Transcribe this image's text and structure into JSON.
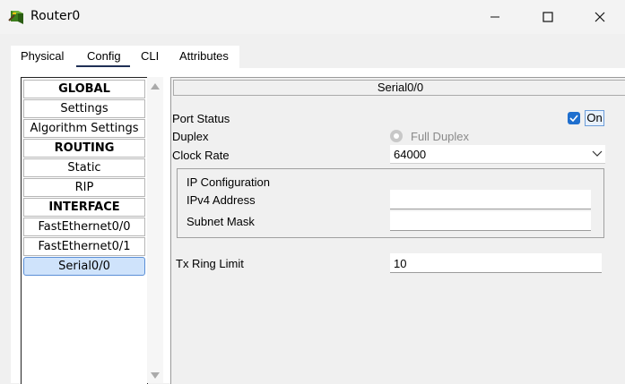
{
  "window": {
    "title": "Router0",
    "icon": "router-icon"
  },
  "tabs": [
    {
      "label": "Physical"
    },
    {
      "label": "Config",
      "active": true
    },
    {
      "label": "CLI"
    },
    {
      "label": "Attributes"
    }
  ],
  "nav": {
    "items": [
      {
        "label": "GLOBAL",
        "type": "header"
      },
      {
        "label": "Settings",
        "type": "item"
      },
      {
        "label": "Algorithm Settings",
        "type": "item"
      },
      {
        "label": "ROUTING",
        "type": "header"
      },
      {
        "label": "Static",
        "type": "item"
      },
      {
        "label": "RIP",
        "type": "item"
      },
      {
        "label": "INTERFACE",
        "type": "header"
      },
      {
        "label": "FastEthernet0/0",
        "type": "item"
      },
      {
        "label": "FastEthernet0/1",
        "type": "item"
      },
      {
        "label": "Serial0/0",
        "type": "item",
        "selected": true
      }
    ]
  },
  "panel": {
    "title": "Serial0/0",
    "port_status": {
      "label": "Port Status",
      "checked": true,
      "on_label": "On"
    },
    "duplex": {
      "label": "Duplex",
      "option_label": "Full Duplex",
      "disabled": true
    },
    "clock_rate": {
      "label": "Clock Rate",
      "value": "64000"
    },
    "ip_config": {
      "title": "IP Configuration",
      "ipv4_label": "IPv4 Address",
      "ipv4_value": "",
      "subnet_label": "Subnet Mask",
      "subnet_value": ""
    },
    "tx_ring": {
      "label": "Tx Ring Limit",
      "value": "10"
    }
  },
  "colors": {
    "accent": "#1f6fce",
    "selected_bg": "#cfe3fb",
    "tab_underline": "#1f2f55"
  }
}
